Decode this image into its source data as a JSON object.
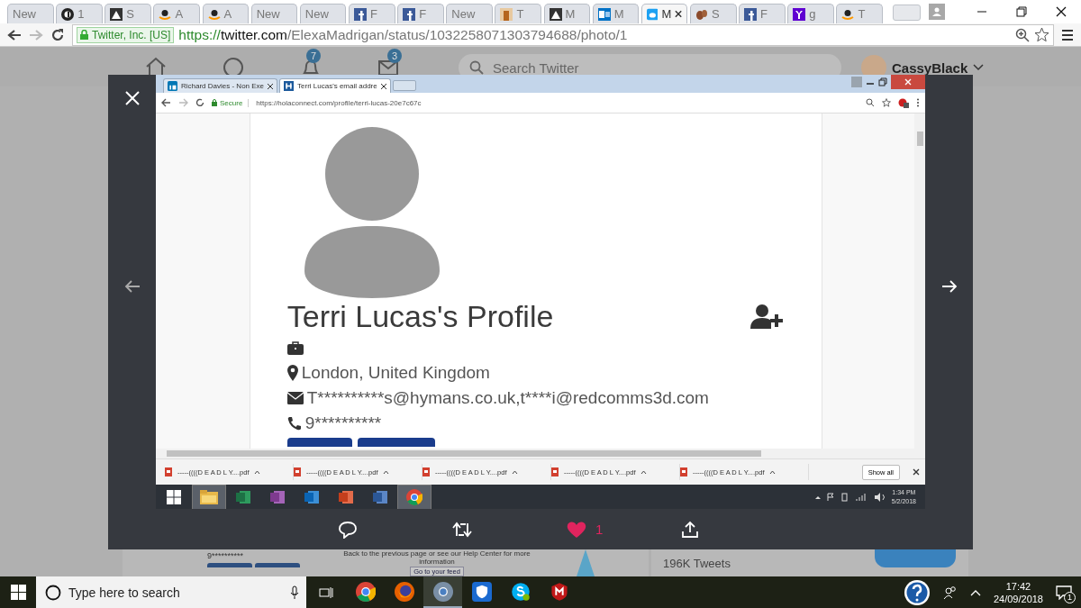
{
  "browser": {
    "tabs": [
      {
        "label": "New",
        "kind": "plain",
        "selected": false
      },
      {
        "label": "1",
        "kind": "dark-circle",
        "selected": false
      },
      {
        "label": "S",
        "kind": "dark-square",
        "selected": false
      },
      {
        "label": "A",
        "kind": "smile",
        "selected": false
      },
      {
        "label": "A",
        "kind": "smile",
        "selected": false
      },
      {
        "label": "New",
        "kind": "plain",
        "selected": false
      },
      {
        "label": "New",
        "kind": "plain",
        "selected": false
      },
      {
        "label": "F",
        "kind": "blue-square",
        "selected": false
      },
      {
        "label": "F",
        "kind": "blue-square",
        "selected": false
      },
      {
        "label": "New",
        "kind": "plain",
        "selected": false
      },
      {
        "label": "T",
        "kind": "photo",
        "selected": false
      },
      {
        "label": "M",
        "kind": "dark-square",
        "selected": false
      },
      {
        "label": "M",
        "kind": "mail",
        "selected": false
      },
      {
        "label": "M",
        "kind": "bird",
        "selected": true
      },
      {
        "label": "S",
        "kind": "moth",
        "selected": false
      },
      {
        "label": "F",
        "kind": "blue-square",
        "selected": false
      },
      {
        "label": "g",
        "kind": "purple",
        "selected": false
      },
      {
        "label": "T",
        "kind": "smile",
        "selected": false
      }
    ],
    "security_badge": "Twitter, Inc. [US]",
    "url_scheme": "https://",
    "url_host": "twitter.com",
    "url_path": "/ElexaMadrigan/status/1032258071303794688/photo/1"
  },
  "twitter_nav": {
    "notifications_badge": "7",
    "messages_badge": "3",
    "search_placeholder": "Search Twitter",
    "username": "CassyBlack"
  },
  "behind": {
    "phone": "9**********",
    "help_text": "Back to the previous page or see our Help Center for more information",
    "feed_button": "Go to your feed",
    "tweets_count": "196K Tweets"
  },
  "photo": {
    "tabs": [
      {
        "label": "Richard Davies - Non Exe",
        "kind": "linked",
        "selected": false
      },
      {
        "label": "Terri Lucas's email addre",
        "kind": "hola",
        "selected": true
      }
    ],
    "secure": "Secure",
    "url": "https://holaconnect.com/profile/terri-lucas-20e7c67c",
    "profile": {
      "title": "Terri Lucas's Profile",
      "location": "London, United Kingdom",
      "email": "T**********s@hymans.co.uk,t****i@redcomms3d.com",
      "phone": "9**********"
    },
    "downloads": [
      "-----((((D E A D L Y....pdf",
      "-----((((D E A D L Y....pdf",
      "-----((((D E A D L Y....pdf",
      "-----((((D E A D L Y....pdf",
      "-----((((D E A D L Y....pdf"
    ],
    "show_all": "Show all",
    "taskbar_apps": [
      {
        "kind": "folder",
        "active": true
      },
      {
        "kind": "green",
        "active": false
      },
      {
        "kind": "purple",
        "active": false
      },
      {
        "kind": "blue",
        "active": false
      },
      {
        "kind": "orange",
        "active": false
      },
      {
        "kind": "word",
        "active": false
      },
      {
        "kind": "chrome",
        "active": true
      }
    ],
    "time": "1:34 PM",
    "date": "5/2/2018"
  },
  "actions": {
    "likes": "1",
    "liked": true
  },
  "taskbar": {
    "search_placeholder": "Type here to search",
    "apps": [
      {
        "kind": "chrome",
        "active": false
      },
      {
        "kind": "firefox",
        "active": false
      },
      {
        "kind": "chrome-grey",
        "active": true
      },
      {
        "kind": "shield",
        "active": false
      },
      {
        "kind": "skype",
        "active": false
      },
      {
        "kind": "mcafee",
        "active": false
      }
    ],
    "time": "17:42",
    "date": "24/09/2018",
    "notifications": "1"
  }
}
